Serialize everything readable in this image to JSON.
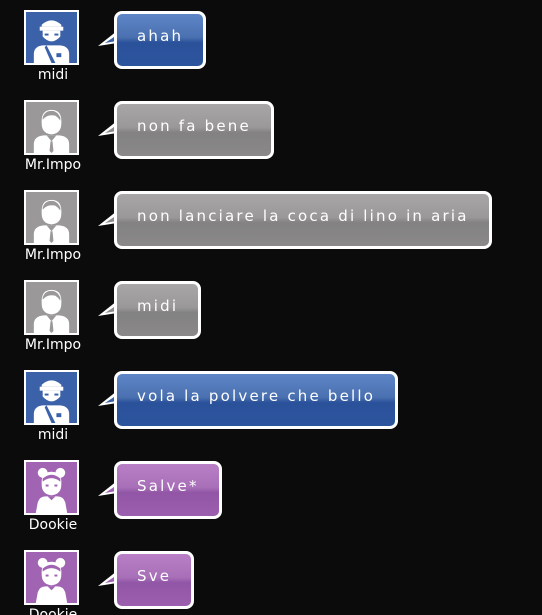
{
  "colors": {
    "background": "#0b0b0b",
    "blue": "#3b62a8",
    "gray": "#8e8c8c",
    "purple": "#a064b2",
    "bubble_border": "#ffffff"
  },
  "messages": [
    {
      "user": "midi",
      "text": "ahah",
      "color": "blue",
      "avatar_icon": "headband-man-icon"
    },
    {
      "user": "Mr.Impo",
      "text": "non fa bene",
      "color": "gray",
      "avatar_icon": "man-with-tie-icon"
    },
    {
      "user": "Mr.Impo",
      "text": "non lanciare la coca di lino in aria",
      "color": "gray",
      "avatar_icon": "man-with-tie-icon"
    },
    {
      "user": "Mr.Impo",
      "text": "midi",
      "color": "gray",
      "avatar_icon": "man-with-tie-icon"
    },
    {
      "user": "midi",
      "text": "vola la polvere che bello",
      "color": "blue",
      "avatar_icon": "headband-man-icon"
    },
    {
      "user": "Dookie",
      "text": "Salve*",
      "color": "purple",
      "avatar_icon": "girl-with-buns-icon"
    },
    {
      "user": "Dookie",
      "text": "Sve",
      "color": "purple",
      "avatar_icon": "girl-with-buns-icon"
    }
  ]
}
